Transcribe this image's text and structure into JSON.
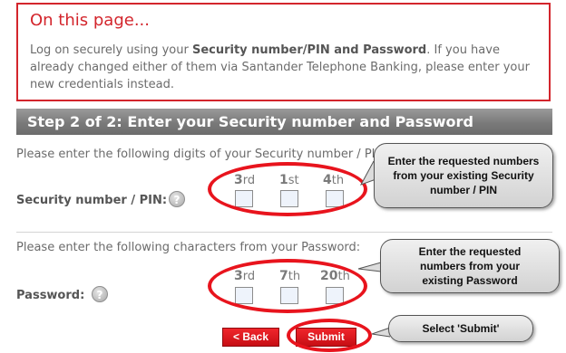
{
  "info": {
    "title": "On this page...",
    "text_before": "Log on securely using your ",
    "text_bold": "Security number/PIN and Password",
    "text_after": ". If you have already changed either of them via Santander Telephone Banking, please enter your new credentials instead."
  },
  "step": {
    "title": "Step 2 of 2: Enter your Security number and Password"
  },
  "security": {
    "instruction": "Please enter the following digits of your Security number / PIN:",
    "label": "Security number / PIN:",
    "positions": [
      {
        "num": "3",
        "suffix": "rd"
      },
      {
        "num": "1",
        "suffix": "st"
      },
      {
        "num": "4",
        "suffix": "th"
      }
    ]
  },
  "password": {
    "instruction": "Please enter the following characters from your Password:",
    "label": "Password:",
    "positions": [
      {
        "num": "3",
        "suffix": "rd"
      },
      {
        "num": "7",
        "suffix": "th"
      },
      {
        "num": "20",
        "suffix": "th"
      }
    ]
  },
  "buttons": {
    "back": "< Back",
    "submit": "Submit"
  },
  "callouts": {
    "security": "Enter the requested numbers from your existing Security number / PIN",
    "password": "Enter the requested numbers from your existing Password",
    "submit": "Select 'Submit'"
  },
  "colors": {
    "brand_red": "#d3252c",
    "annotation_red": "#e8141d",
    "step_bar_gray": "#7a7a7a"
  },
  "icons": {
    "help": "help-icon"
  }
}
